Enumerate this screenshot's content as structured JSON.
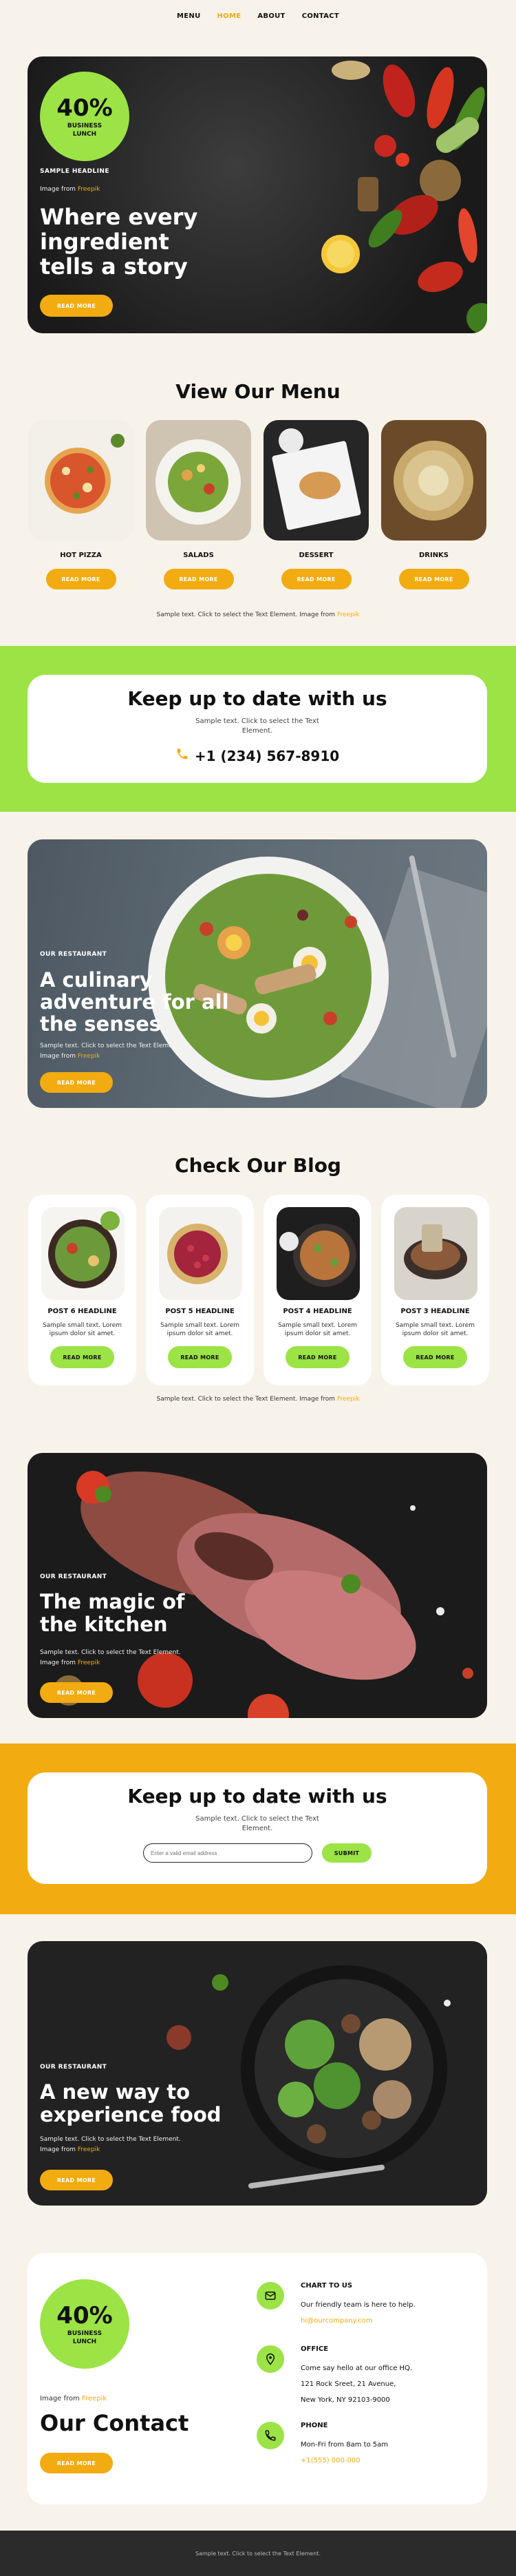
{
  "nav": {
    "items": [
      "MENU",
      "HOME",
      "ABOUT",
      "CONTACT"
    ]
  },
  "hero": {
    "badge_pct": "40%",
    "badge_label_1": "BUSINESS",
    "badge_label_2": "LUNCH",
    "eyebrow": "SAMPLE HEADLINE",
    "image_from": "Image from",
    "freepik": "Freepik",
    "title_1": "Where every",
    "title_2": "ingredient",
    "title_3": "tells a story",
    "button": "READ MORE"
  },
  "menu": {
    "title": "View Our Menu",
    "items": [
      {
        "label": "HOT PIZZA",
        "button": "READ MORE"
      },
      {
        "label": "SALADS",
        "button": "READ MORE"
      },
      {
        "label": "DESSERT",
        "button": "READ MORE"
      },
      {
        "label": "DRINKS",
        "button": "READ MORE"
      }
    ],
    "caption": "Sample text. Click to select the Text Element. Image from",
    "caption_link": "Freepik"
  },
  "newsletter_phone": {
    "title": "Keep up to date with us",
    "text_1": "Sample text. Click to select the Text",
    "text_2": "Element.",
    "phone": "+1 (234) 567-8910"
  },
  "salad_banner": {
    "eyebrow": "OUR RESTAURANT",
    "title_1": "A culinary",
    "title_2": "adventure for all",
    "title_3": "the senses",
    "text": "Sample text. Click to select the Text Element.",
    "image_from": "Image from",
    "freepik": "Freepik",
    "button": "READ MORE"
  },
  "blog": {
    "title": "Check Our Blog",
    "posts": [
      {
        "headline": "POST 6 HEADLINE",
        "text": "Sample small text. Lorem ipsum dolor sit amet.",
        "button": "READ MORE"
      },
      {
        "headline": "POST 5 HEADLINE",
        "text": "Sample small text. Lorem ipsum dolor sit amet.",
        "button": "READ MORE"
      },
      {
        "headline": "POST 4 HEADLINE",
        "text": "Sample small text. Lorem ipsum dolor sit amet.",
        "button": "READ MORE"
      },
      {
        "headline": "POST 3 HEADLINE",
        "text": "Sample small text. Lorem ipsum dolor sit amet.",
        "button": "READ MORE"
      }
    ],
    "caption": "Sample text. Click to select the Text Element. Image from",
    "caption_link": "Freepik"
  },
  "steak_banner": {
    "eyebrow": "OUR RESTAURANT",
    "title_1": "The magic of",
    "title_2": "the kitchen",
    "text": "Sample text. Click to select the Text Element.",
    "image_from": "Image from",
    "freepik": "Freepik",
    "button": "READ MORE"
  },
  "newsletter_email": {
    "title": "Keep up to date with us",
    "text_1": "Sample text. Click to select the Text",
    "text_2": "Element.",
    "placeholder": "Enter a valid email address",
    "button": "SUBMIT"
  },
  "bowl_banner": {
    "eyebrow": "OUR RESTAURANT",
    "title_1": "A new way to",
    "title_2": "experience food",
    "text": "Sample text. Click to select the Text Element.",
    "image_from": "Image from",
    "freepik": "Freepik",
    "button": "READ MORE"
  },
  "contact": {
    "badge_pct": "40%",
    "badge_label_1": "BUSINESS",
    "badge_label_2": "LUNCH",
    "image_from": "Image from",
    "freepik": "Freepik",
    "title": "Our Contact",
    "button": "READ MORE",
    "chat": {
      "heading": "CHART TO US",
      "line": "Our friendly team is here to help.",
      "email": "hi@ourcompany.com"
    },
    "office": {
      "heading": "OFFICE",
      "line_1": "Come say hello at our office HQ.",
      "line_2": "121 Rock Sreet, 21 Avenue,",
      "line_3": "New York, NY 92103-9000"
    },
    "phone": {
      "heading": "PHONE",
      "line": "Mon-Fri from 8am to 5am",
      "number": "+1(555) 000-000"
    }
  },
  "footer": {
    "text": "Sample text. Click to select the Text Element."
  },
  "colors": {
    "accent_yellow": "#f2ab10",
    "accent_green": "#9ce346",
    "background": "#f8f3ea",
    "footer": "#2b2b2b"
  }
}
